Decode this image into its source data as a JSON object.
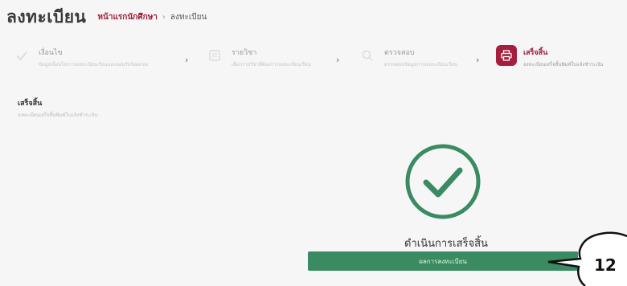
{
  "header": {
    "title": "ลงทะเบียน",
    "breadcrumb": {
      "link": "หน้าแรกนักศึกษา",
      "separator": "›",
      "current": "ลงทะเบียน"
    }
  },
  "steps": [
    {
      "title": "เงื่อนไข",
      "desc": "ข้อมูลเงื่อนไขการลงทะเบียนเรียนและยอมรับข้อตกลง",
      "state": "done",
      "icon": "check-icon"
    },
    {
      "title": "รายวิชา",
      "desc": "เลือกรายวิชาที่ต้องการลงทะเบียนเรียน",
      "state": "done",
      "icon": "book-icon"
    },
    {
      "title": "ตรวจสอบ",
      "desc": "ตรวจสอบข้อมูลการลงทะเบียนเรียน",
      "state": "done",
      "icon": "search-icon"
    },
    {
      "title": "เสร็จสิ้น",
      "desc": "ลงทะเบียนเสร็จสิ้นพิมพ์ใบแจ้งชำระเงิน",
      "state": "active",
      "icon": "printer-icon"
    }
  ],
  "step_separator": "›",
  "section": {
    "title": "เสร็จสิ้น",
    "desc": "ลงทะเบียนเสร็จสิ้นพิมพ์ใบแจ้งชำระเงิน"
  },
  "success": {
    "message": "ดำเนินการเสร็จสิ้น",
    "button_label": "ผลการลงทะเบียน"
  },
  "annotation": {
    "number": "12"
  },
  "colors": {
    "accent": "#a51f3d",
    "success": "#3a8a62"
  }
}
